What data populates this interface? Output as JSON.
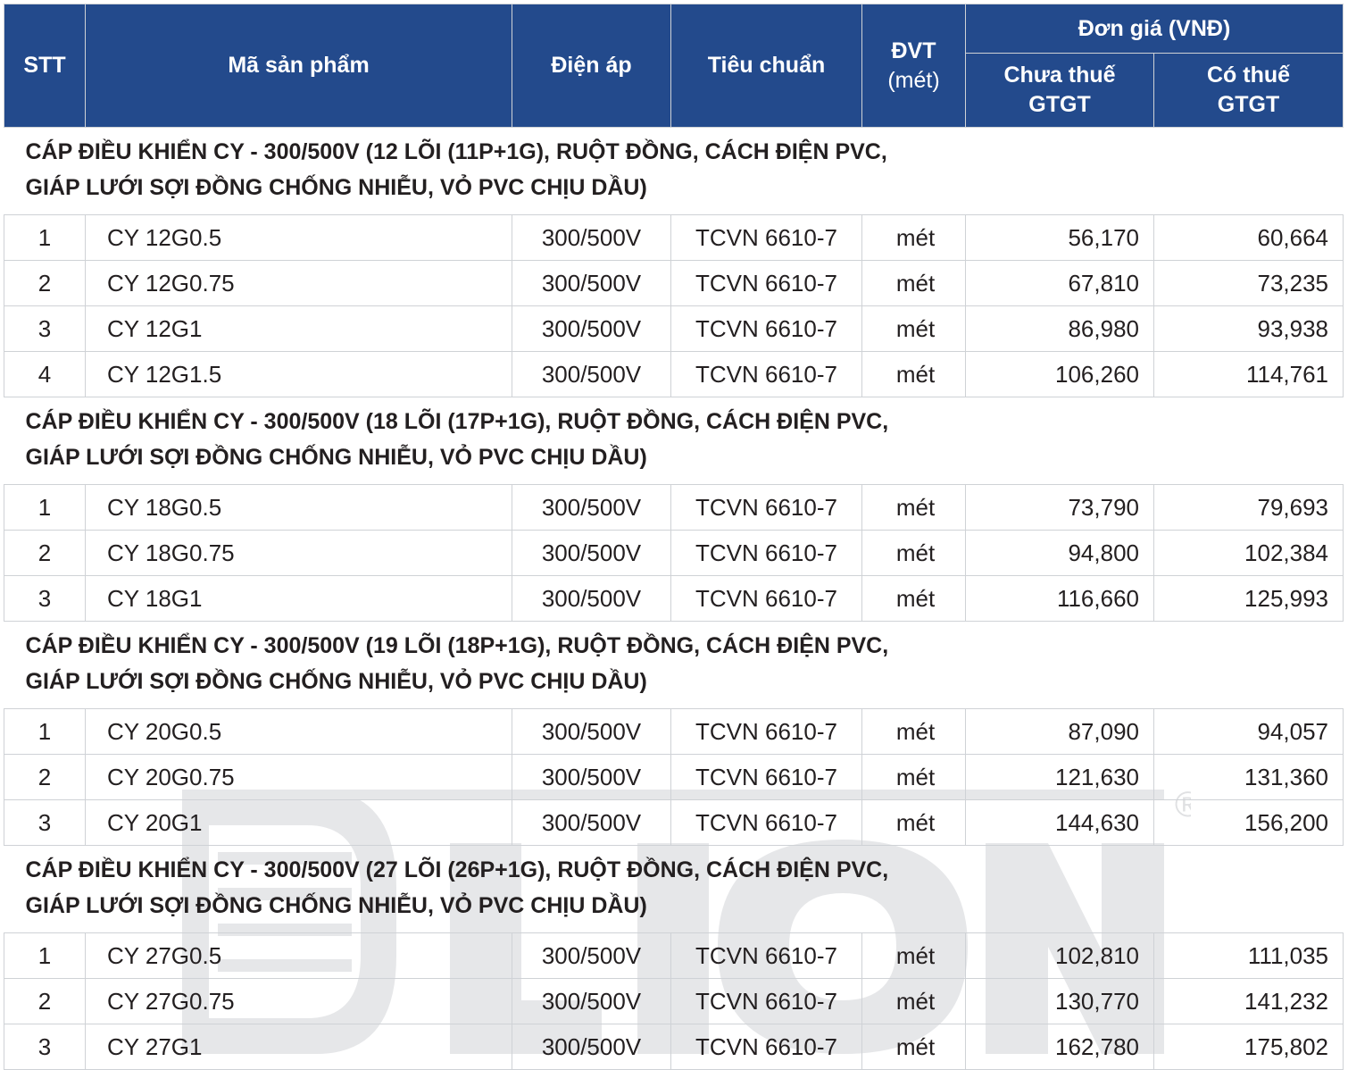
{
  "header": {
    "stt": "STT",
    "product_code": "Mã sản phẩm",
    "voltage": "Điện áp",
    "standard": "Tiêu chuẩn",
    "unit_line1": "ĐVT",
    "unit_line2": "(mét)",
    "price_group": "Đơn giá (VNĐ)",
    "price_excl_line1": "Chưa thuế",
    "price_excl_line2": "GTGT",
    "price_incl_line1": "Có thuế",
    "price_incl_line2": "GTGT"
  },
  "sections": [
    {
      "title_line1": "CÁP ĐIỀU KHIỂN CY - 300/500V (12 LÕI (11P+1G), RUỘT ĐỒNG, CÁCH ĐIỆN PVC,",
      "title_line2": "GIÁP LƯỚI SỢI ĐỒNG CHỐNG NHIỄU, VỎ PVC CHỊU DẦU)",
      "rows": [
        {
          "stt": "1",
          "code": "CY 12G0.5",
          "voltage": "300/500V",
          "standard": "TCVN 6610-7",
          "unit": "mét",
          "price_excl": "56,170",
          "price_incl": "60,664"
        },
        {
          "stt": "2",
          "code": "CY 12G0.75",
          "voltage": "300/500V",
          "standard": "TCVN 6610-7",
          "unit": "mét",
          "price_excl": "67,810",
          "price_incl": "73,235"
        },
        {
          "stt": "3",
          "code": "CY 12G1",
          "voltage": "300/500V",
          "standard": "TCVN 6610-7",
          "unit": "mét",
          "price_excl": "86,980",
          "price_incl": "93,938"
        },
        {
          "stt": "4",
          "code": "CY 12G1.5",
          "voltage": "300/500V",
          "standard": "TCVN 6610-7",
          "unit": "mét",
          "price_excl": "106,260",
          "price_incl": "114,761"
        }
      ]
    },
    {
      "title_line1": "CÁP ĐIỀU KHIỂN CY - 300/500V (18 LÕI (17P+1G), RUỘT ĐỒNG, CÁCH ĐIỆN PVC,",
      "title_line2": "GIÁP LƯỚI SỢI ĐỒNG CHỐNG NHIỄU, VỎ PVC CHỊU DẦU)",
      "rows": [
        {
          "stt": "1",
          "code": "CY 18G0.5",
          "voltage": "300/500V",
          "standard": "TCVN 6610-7",
          "unit": "mét",
          "price_excl": "73,790",
          "price_incl": "79,693"
        },
        {
          "stt": "2",
          "code": "CY 18G0.75",
          "voltage": "300/500V",
          "standard": "TCVN 6610-7",
          "unit": "mét",
          "price_excl": "94,800",
          "price_incl": "102,384"
        },
        {
          "stt": "3",
          "code": "CY 18G1",
          "voltage": "300/500V",
          "standard": "TCVN 6610-7",
          "unit": "mét",
          "price_excl": "116,660",
          "price_incl": "125,993"
        }
      ]
    },
    {
      "title_line1": "CÁP ĐIỀU KHIỂN CY - 300/500V (19 LÕI (18P+1G), RUỘT ĐỒNG, CÁCH ĐIỆN PVC,",
      "title_line2": "GIÁP LƯỚI SỢI ĐỒNG CHỐNG NHIỄU, VỎ PVC CHỊU DẦU)",
      "rows": [
        {
          "stt": "1",
          "code": "CY 20G0.5",
          "voltage": "300/500V",
          "standard": "TCVN 6610-7",
          "unit": "mét",
          "price_excl": "87,090",
          "price_incl": "94,057"
        },
        {
          "stt": "2",
          "code": "CY 20G0.75",
          "voltage": "300/500V",
          "standard": "TCVN 6610-7",
          "unit": "mét",
          "price_excl": "121,630",
          "price_incl": "131,360"
        },
        {
          "stt": "3",
          "code": "CY 20G1",
          "voltage": "300/500V",
          "standard": "TCVN 6610-7",
          "unit": "mét",
          "price_excl": "144,630",
          "price_incl": "156,200"
        }
      ]
    },
    {
      "title_line1": "CÁP ĐIỀU KHIỂN CY - 300/500V (27 LÕI (26P+1G), RUỘT ĐỒNG, CÁCH ĐIỆN PVC,",
      "title_line2": "GIÁP LƯỚI SỢI ĐỒNG CHỐNG NHIỄU, VỎ PVC CHỊU DẦU)",
      "rows": [
        {
          "stt": "1",
          "code": "CY 27G0.5",
          "voltage": "300/500V",
          "standard": "TCVN 6610-7",
          "unit": "mét",
          "price_excl": "102,810",
          "price_incl": "111,035"
        },
        {
          "stt": "2",
          "code": "CY 27G0.75",
          "voltage": "300/500V",
          "standard": "TCVN 6610-7",
          "unit": "mét",
          "price_excl": "130,770",
          "price_incl": "141,232"
        },
        {
          "stt": "3",
          "code": "CY 27G1",
          "voltage": "300/500V",
          "standard": "TCVN 6610-7",
          "unit": "mét",
          "price_excl": "162,780",
          "price_incl": "175,802"
        }
      ]
    }
  ],
  "watermark": {
    "text": "DLION",
    "mark": "®",
    "color": "#e8e9ea"
  },
  "colors": {
    "header_bg": "#234a8c",
    "header_text": "#ffffff",
    "border": "#cfd2d6"
  }
}
